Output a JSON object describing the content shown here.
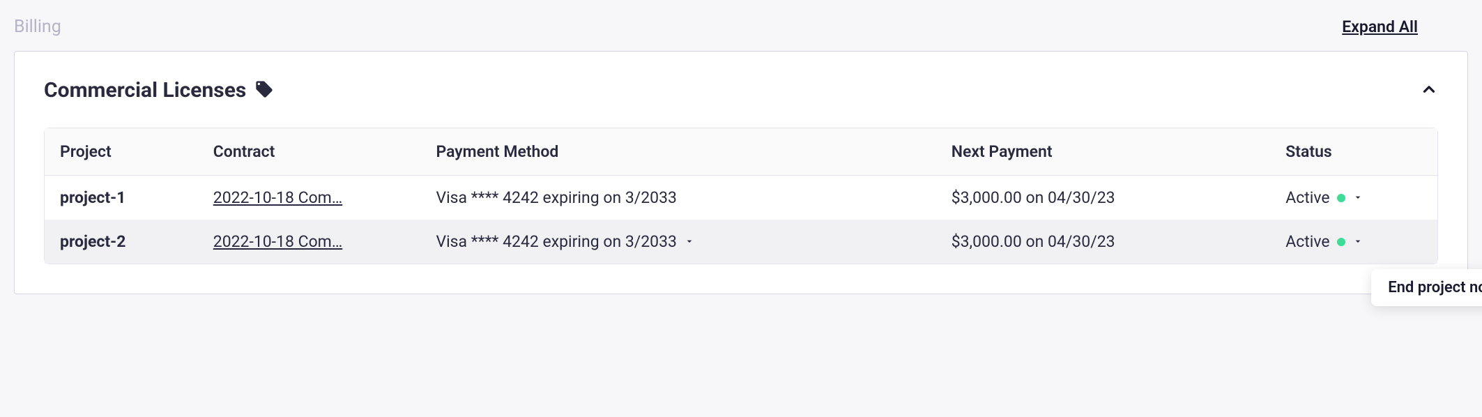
{
  "topbar": {
    "breadcrumb": "Billing",
    "expand_all": "Expand All"
  },
  "panel": {
    "title": "Commercial Licenses"
  },
  "table": {
    "headers": {
      "project": "Project",
      "contract": "Contract",
      "payment_method": "Payment Method",
      "next_payment": "Next Payment",
      "status": "Status"
    },
    "rows": [
      {
        "project": "project-1",
        "contract": "2022-10-18 Com…",
        "payment_method": "Visa **** 4242 expiring on 3/2033",
        "next_payment": "$3,000.00 on 04/30/23",
        "status": "Active",
        "show_pm_caret": false,
        "highlight": false
      },
      {
        "project": "project-2",
        "contract": "2022-10-18 Com…",
        "payment_method": "Visa **** 4242 expiring on 3/2033",
        "next_payment": "$3,000.00 on 04/30/23",
        "status": "Active",
        "show_pm_caret": true,
        "highlight": true
      }
    ]
  },
  "popover": {
    "label": "End project now"
  }
}
